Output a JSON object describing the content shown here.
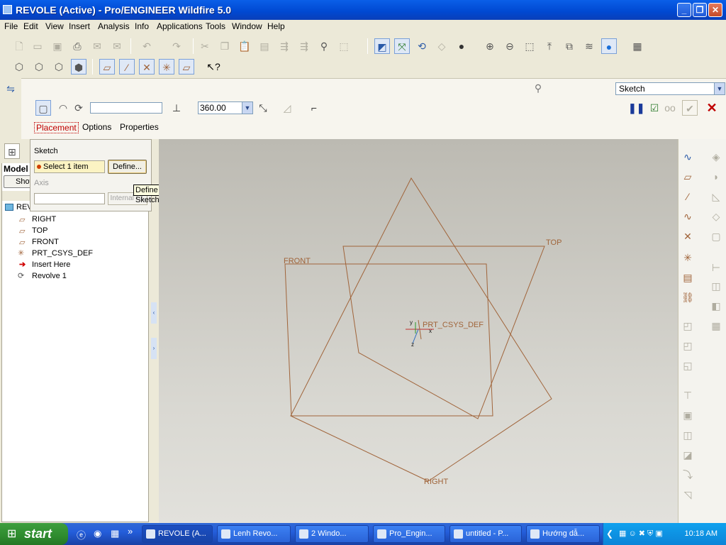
{
  "window": {
    "title": "REVOLE (Active) - Pro/ENGINEER Wildfire 5.0"
  },
  "menu": [
    "File",
    "Edit",
    "View",
    "Insert",
    "Analysis",
    "Info",
    "Applications",
    "Tools",
    "Window",
    "Help"
  ],
  "dashboard": {
    "angle_value": "360.00",
    "tabs": {
      "placement": "Placement",
      "options": "Options",
      "properties": "Properties"
    },
    "sketch_mode": "Sketch"
  },
  "placement": {
    "sketch_label": "Sketch",
    "select_item": "Select 1 item",
    "define_button": "Define...",
    "axis_label": "Axis",
    "internal_button": "Internal CL",
    "tooltip": "Define an Internal Sketch"
  },
  "tree": {
    "tab_label": "Model",
    "show_button": "Show",
    "root": "REV",
    "items": [
      "RIGHT",
      "TOP",
      "FRONT",
      "PRT_CSYS_DEF",
      "Insert Here",
      "Revolve 1"
    ]
  },
  "graphics": {
    "planes": {
      "front": "FRONT",
      "top": "TOP",
      "right": "RIGHT"
    },
    "csys": "PRT_CSYS_DEF",
    "axes": {
      "x": "x",
      "y": "y",
      "z": "z"
    },
    "datum_color": "#a0643a"
  },
  "taskbar": {
    "start": "start",
    "tasks": [
      "REVOLE (A...",
      "Lenh Revo...",
      "2 Windo...",
      "Pro_Engin...",
      "untitled - P...",
      "Hướng dẫ..."
    ],
    "clock": "10:18 AM"
  }
}
